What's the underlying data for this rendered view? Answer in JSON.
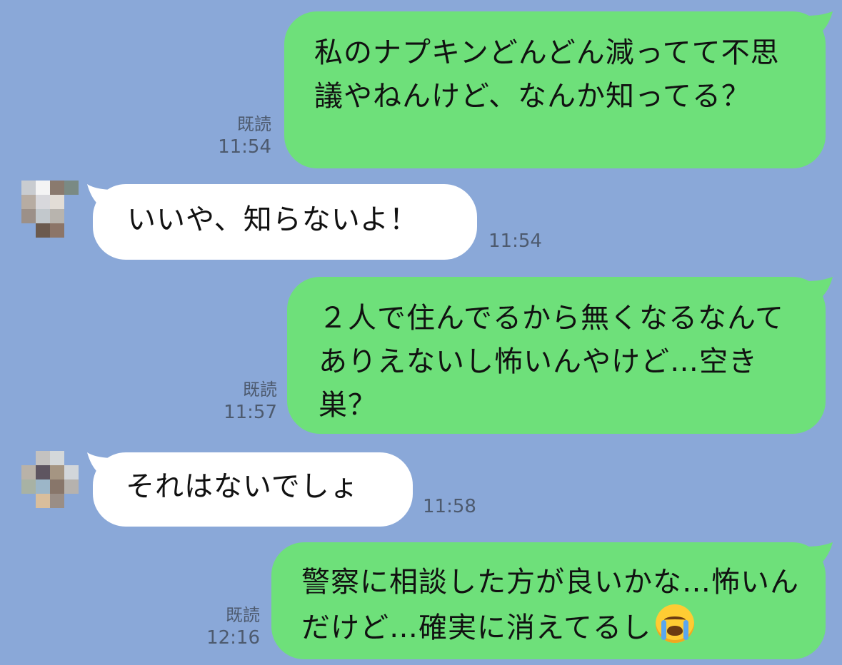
{
  "messages": [
    {
      "side": "out",
      "text": "私のナプキンどんどん減ってて不思議やねんけど、なんか知ってる？",
      "read": "既読",
      "time": "11:54"
    },
    {
      "side": "in",
      "text": "いいや、知らないよ！",
      "time": "11:54"
    },
    {
      "side": "out",
      "text": "２人で住んでるから無くなるなんてありえないし怖いんやけど…空き巣？",
      "read": "既読",
      "time": "11:57"
    },
    {
      "side": "in",
      "text": "それはないでしょ",
      "time": "11:58"
    },
    {
      "side": "out",
      "text": "警察に相談した方が良いかな…怖いんだけど…確実に消えてるし",
      "emoji": "loudly-crying-face-icon",
      "read": "既読",
      "time": "12:16"
    }
  ],
  "colors": {
    "background": "#8aa8d8",
    "outgoing_bubble": "#6ee07a",
    "incoming_bubble": "#ffffff",
    "meta_text": "#4d5a6e"
  }
}
